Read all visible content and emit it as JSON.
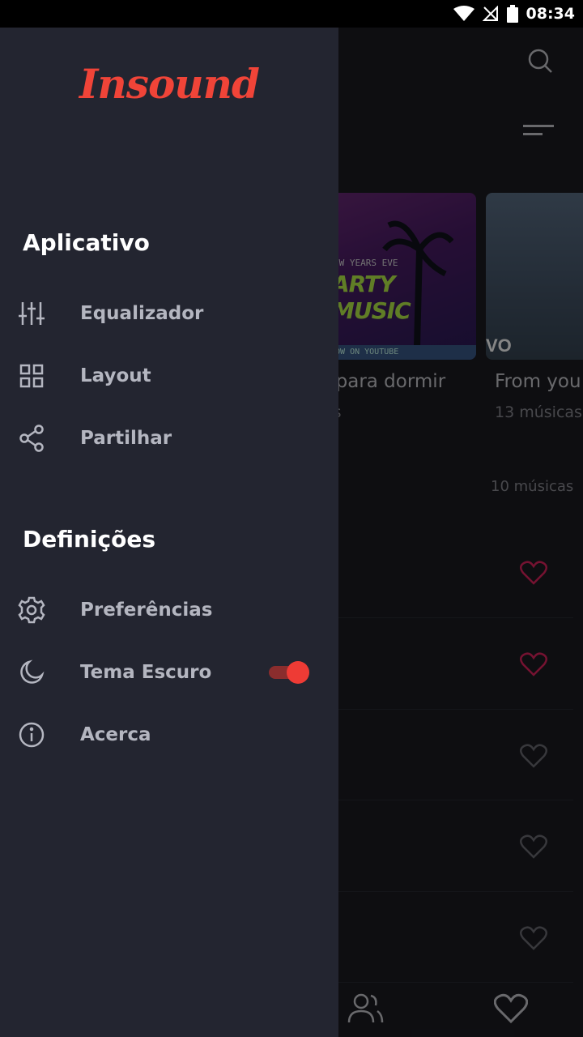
{
  "status_bar": {
    "time": "08:34"
  },
  "drawer": {
    "logo": "Insound",
    "sections": [
      {
        "title": "Aplicativo",
        "items": [
          {
            "label": "Equalizador",
            "icon": "equalizer-icon"
          },
          {
            "label": "Layout",
            "icon": "grid-icon"
          },
          {
            "label": "Partilhar",
            "icon": "share-icon"
          }
        ]
      },
      {
        "title": "Definições",
        "items": [
          {
            "label": "Preferências",
            "icon": "gear-icon"
          },
          {
            "label": "Tema Escuro",
            "icon": "moon-icon",
            "toggle": true
          },
          {
            "label": "Acerca",
            "icon": "info-icon"
          }
        ]
      }
    ]
  },
  "background": {
    "cards": [
      {
        "title": ", para dormir",
        "subtitle": "as",
        "art_line1": "EW YEARS EVE",
        "art_line2": "ARTY MUSIC",
        "art_banner": "NOW ON YOUTUBE"
      },
      {
        "title": "From you",
        "subtitle": "13 músicas",
        "art_text": "VO"
      }
    ],
    "song_count": "10 músicas"
  },
  "colors": {
    "accent": "#ee3b35",
    "drawer_bg": "#232530",
    "heart_active": "#e0245e"
  }
}
